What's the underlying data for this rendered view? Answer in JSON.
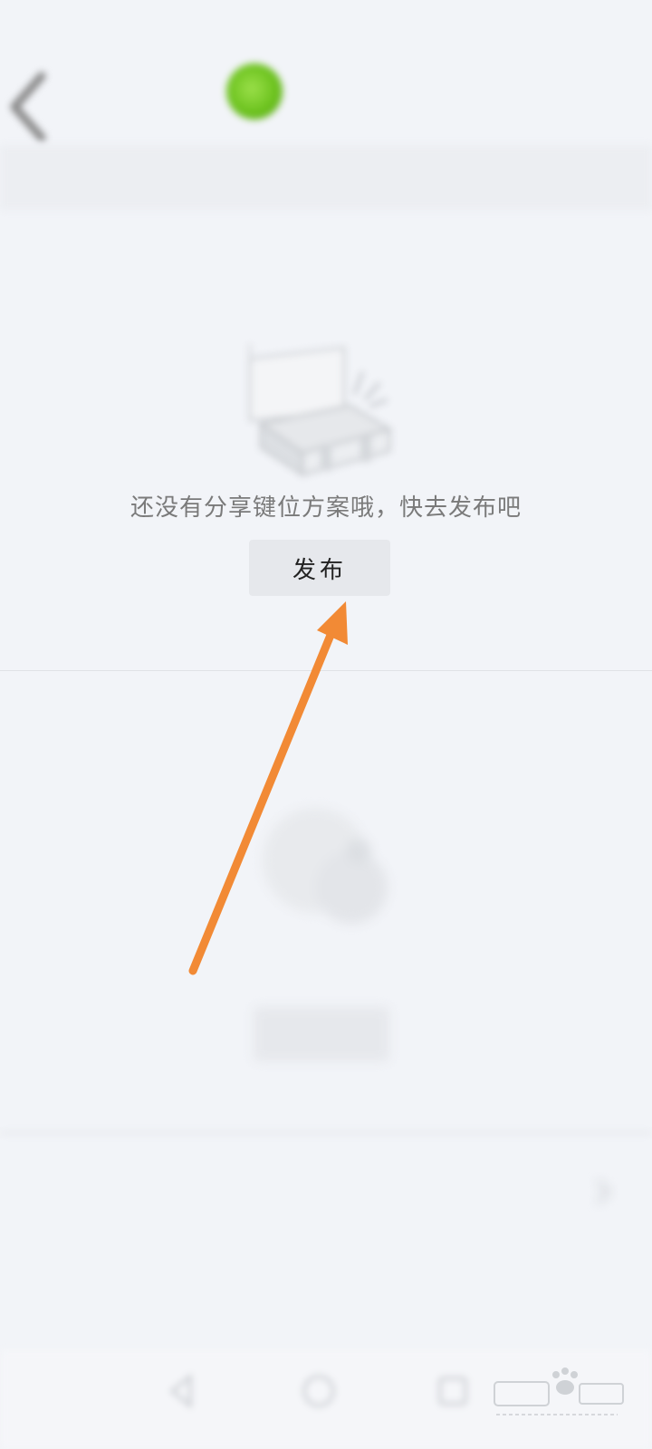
{
  "status_bar": {
    "left": "",
    "right": ""
  },
  "header": {
    "nickname": ""
  },
  "notice": {
    "text": ""
  },
  "sections": [
    {
      "title": "",
      "empty_text": "还没有分享键位方案哦，快去发布吧",
      "button_label": "发布"
    },
    {
      "title": "",
      "empty_text": "",
      "button_label": ""
    }
  ],
  "row_item": {
    "label": ""
  },
  "colors": {
    "background": "#f2f4f8",
    "button_bg": "#e6e8ec",
    "arrow": "#f28a35",
    "avatar": "#6cc21e"
  },
  "icons": [
    "back-icon",
    "box-icon",
    "cloud-icon",
    "chevron-right-icon",
    "nav-back-icon",
    "nav-home-icon",
    "nav-recent-icon"
  ]
}
